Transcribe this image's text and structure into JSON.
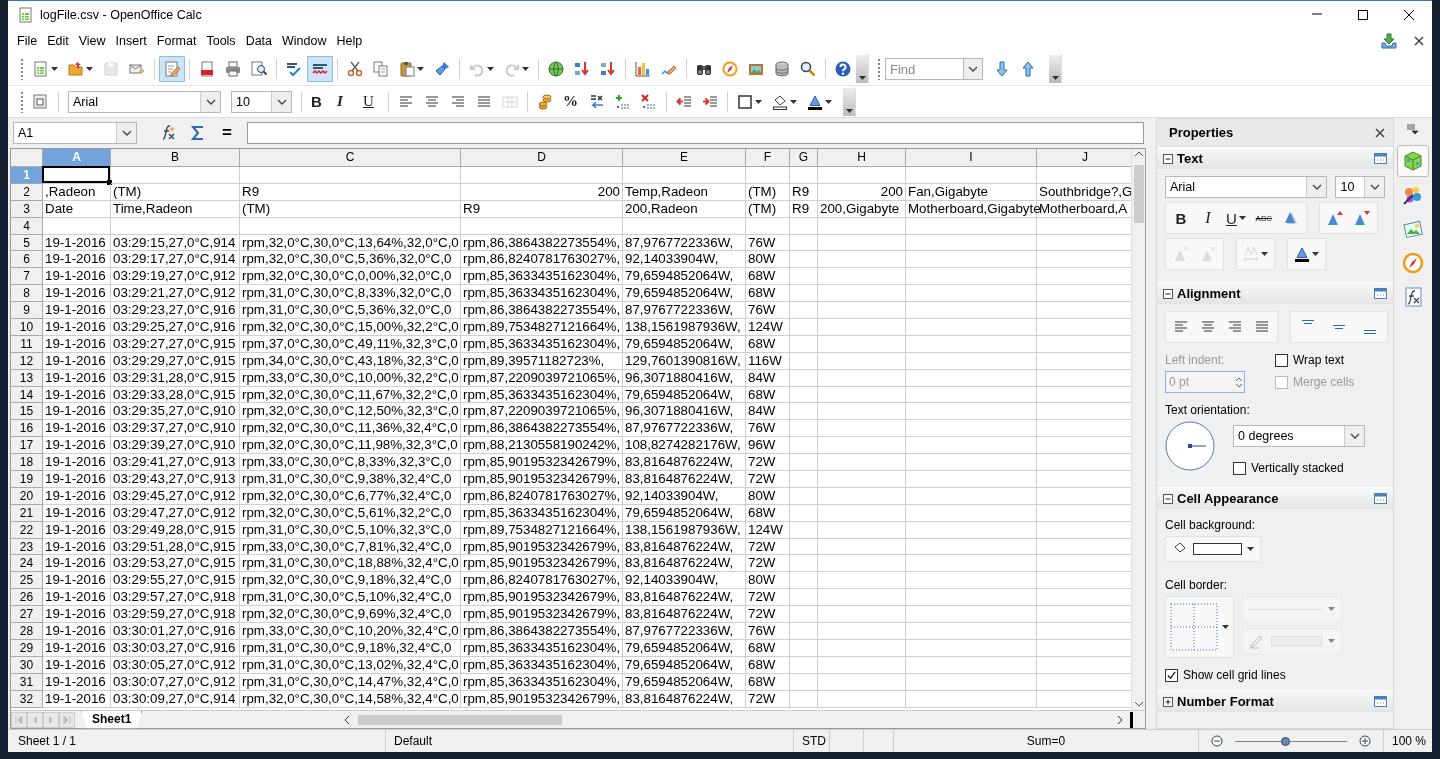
{
  "window": {
    "title": "logFile.csv - OpenOffice Calc"
  },
  "menu": [
    "File",
    "Edit",
    "View",
    "Insert",
    "Format",
    "Tools",
    "Data",
    "Window",
    "Help"
  ],
  "toolbar_1": {
    "groups": [
      [
        {
          "kind": "button",
          "pressed": false,
          "disabled": false,
          "dropdown": true
        },
        {
          "kind": "button",
          "pressed": false,
          "disabled": false,
          "dropdown": true
        },
        {
          "kind": "button",
          "pressed": false,
          "disabled": true,
          "dropdown": false
        },
        {
          "kind": "button",
          "pressed": false,
          "disabled": false,
          "dropdown": false
        }
      ],
      [
        {
          "kind": "button",
          "pressed": true,
          "disabled": false,
          "dropdown": false
        }
      ],
      [
        {
          "kind": "button",
          "pressed": false,
          "disabled": false,
          "dropdown": false
        },
        {
          "kind": "button",
          "pressed": false,
          "disabled": false,
          "dropdown": false
        },
        {
          "kind": "button",
          "pressed": false,
          "disabled": false,
          "dropdown": false
        }
      ],
      [
        {
          "kind": "button",
          "pressed": false,
          "disabled": false,
          "dropdown": false
        },
        {
          "kind": "button",
          "pressed": true,
          "disabled": false,
          "dropdown": false
        }
      ],
      [
        {
          "kind": "button",
          "pressed": false,
          "disabled": false,
          "dropdown": false
        },
        {
          "kind": "button",
          "pressed": false,
          "disabled": false,
          "dropdown": false
        },
        {
          "kind": "button",
          "pressed": false,
          "disabled": false,
          "dropdown": true
        },
        {
          "kind": "button",
          "pressed": false,
          "disabled": false,
          "dropdown": false
        }
      ],
      [
        {
          "kind": "button",
          "pressed": false,
          "disabled": true,
          "dropdown": true
        },
        {
          "kind": "button",
          "pressed": false,
          "disabled": true,
          "dropdown": true
        }
      ],
      [
        {
          "kind": "button",
          "pressed": false,
          "disabled": false,
          "dropdown": false
        },
        {
          "kind": "button",
          "pressed": false,
          "disabled": false,
          "dropdown": false
        },
        {
          "kind": "button",
          "pressed": false,
          "disabled": false,
          "dropdown": false
        }
      ],
      [
        {
          "kind": "button",
          "pressed": false,
          "disabled": false,
          "dropdown": false
        },
        {
          "kind": "button",
          "pressed": false,
          "disabled": false,
          "dropdown": false
        }
      ],
      [
        {
          "kind": "button",
          "pressed": false,
          "disabled": false,
          "dropdown": false
        },
        {
          "kind": "button",
          "pressed": false,
          "disabled": false,
          "dropdown": false
        },
        {
          "kind": "button",
          "pressed": false,
          "disabled": false,
          "dropdown": false
        },
        {
          "kind": "button",
          "pressed": false,
          "disabled": false,
          "dropdown": false
        },
        {
          "kind": "button",
          "pressed": false,
          "disabled": false,
          "dropdown": false
        }
      ],
      [
        {
          "kind": "button",
          "pressed": false,
          "disabled": false,
          "dropdown": false
        }
      ]
    ]
  },
  "find_toolbar": {
    "placeholder": "Find"
  },
  "toolbar_2": {
    "groups": [
      [
        {
          "kind": "button",
          "pressed": false,
          "disabled": false,
          "dropdown": false
        }
      ],
      [
        {
          "kind": "combo",
          "value": "Arial"
        },
        {
          "kind": "combo",
          "value": "10"
        }
      ],
      [
        {
          "kind": "glyph",
          "text": "B",
          "pressed": false,
          "disabled": false,
          "dropdown": false
        },
        {
          "kind": "glyph",
          "text": "I",
          "pressed": false,
          "disabled": false,
          "dropdown": false
        },
        {
          "kind": "glyph",
          "text": "U",
          "pressed": false,
          "disabled": false,
          "dropdown": false
        }
      ],
      [
        {
          "kind": "button",
          "pressed": false,
          "disabled": false,
          "dropdown": false
        },
        {
          "kind": "button",
          "pressed": false,
          "disabled": false,
          "dropdown": false
        },
        {
          "kind": "button",
          "pressed": false,
          "disabled": false,
          "dropdown": false
        },
        {
          "kind": "button",
          "pressed": false,
          "disabled": false,
          "dropdown": false
        },
        {
          "kind": "button",
          "pressed": false,
          "disabled": true,
          "dropdown": false
        }
      ],
      [
        {
          "kind": "button",
          "pressed": false,
          "disabled": false,
          "dropdown": false
        },
        {
          "kind": "glyph",
          "text": "%",
          "pressed": false,
          "disabled": false,
          "dropdown": false
        },
        {
          "kind": "button",
          "pressed": false,
          "disabled": false,
          "dropdown": false
        },
        {
          "kind": "button",
          "pressed": false,
          "disabled": false,
          "dropdown": false
        },
        {
          "kind": "button",
          "pressed": false,
          "disabled": false,
          "dropdown": false
        }
      ],
      [
        {
          "kind": "button",
          "pressed": false,
          "disabled": false,
          "dropdown": false
        },
        {
          "kind": "button",
          "pressed": false,
          "disabled": false,
          "dropdown": false
        }
      ],
      [
        {
          "kind": "button",
          "pressed": false,
          "disabled": false,
          "dropdown": true
        },
        {
          "kind": "button",
          "pressed": false,
          "disabled": false,
          "dropdown": true
        },
        {
          "kind": "button",
          "pressed": false,
          "disabled": false,
          "dropdown": true
        }
      ]
    ]
  },
  "formula_bar": {
    "name_box": "A1",
    "equals": "="
  },
  "sheet": {
    "columns": [
      {
        "label": "A",
        "selected": true
      },
      {
        "label": "B",
        "selected": false
      },
      {
        "label": "C",
        "selected": false
      },
      {
        "label": "D",
        "selected": false
      },
      {
        "label": "E",
        "selected": false
      },
      {
        "label": "F",
        "selected": false
      },
      {
        "label": "G",
        "selected": false
      },
      {
        "label": "H",
        "selected": false
      },
      {
        "label": "I",
        "selected": false
      },
      {
        "label": "J",
        "selected": false
      }
    ],
    "rows": [
      {
        "header": "1",
        "selected": true,
        "cells": []
      },
      {
        "header": "2",
        "selected": false,
        "cells": [
          ",Radeon",
          "(TM)",
          "R9",
          {
            "kind": "number",
            "text": "200"
          },
          "Temp,Radeon",
          "(TM)",
          "R9",
          {
            "kind": "number",
            "text": "200"
          },
          "Fan,Gigabyte",
          "Southbridge?,G"
        ]
      },
      {
        "header": "3",
        "selected": false,
        "cells": [
          "Date",
          "Time,Radeon",
          "(TM)",
          "R9",
          "200,Radeon",
          "(TM)",
          "R9",
          "200,Gigabyte",
          "Motherboard,Gigabyte",
          "Motherboard,A"
        ]
      },
      {
        "header": "4",
        "selected": false,
        "cells": []
      },
      {
        "header": "5",
        "selected": false,
        "cells": [
          "19-1-2016",
          "03:29:15,27,0°C,914",
          "rpm,32,0°C,30,0°C,13,64%,32,0°C,0",
          "rpm,86,3864382273554%,",
          "87,9767722336W,",
          "76W"
        ]
      },
      {
        "header": "6",
        "selected": false,
        "cells": [
          "19-1-2016",
          "03:29:17,27,0°C,914",
          "rpm,32,0°C,30,0°C,5,36%,32,0°C,0",
          "rpm,86,8240781763027%,",
          "92,14033904W,",
          "80W"
        ]
      },
      {
        "header": "7",
        "selected": false,
        "cells": [
          "19-1-2016",
          "03:29:19,27,0°C,912",
          "rpm,32,0°C,30,0°C,0,00%,32,0°C,0",
          "rpm,85,3633435162304%,",
          "79,6594852064W,",
          "68W"
        ]
      },
      {
        "header": "8",
        "selected": false,
        "cells": [
          "19-1-2016",
          "03:29:21,27,0°C,912",
          "rpm,31,0°C,30,0°C,8,33%,32,0°C,0",
          "rpm,85,3633435162304%,",
          "79,6594852064W,",
          "68W"
        ]
      },
      {
        "header": "9",
        "selected": false,
        "cells": [
          "19-1-2016",
          "03:29:23,27,0°C,916",
          "rpm,31,0°C,30,0°C,5,36%,32,0°C,0",
          "rpm,86,3864382273554%,",
          "87,9767722336W,",
          "76W"
        ]
      },
      {
        "header": "10",
        "selected": false,
        "cells": [
          "19-1-2016",
          "03:29:25,27,0°C,916",
          "rpm,32,0°C,30,0°C,15,00%,32,2°C,0",
          "rpm,89,7534827121664%,",
          "138,1561987936W,",
          "124W"
        ]
      },
      {
        "header": "11",
        "selected": false,
        "cells": [
          "19-1-2016",
          "03:29:27,27,0°C,915",
          "rpm,37,0°C,30,0°C,49,11%,32,3°C,0",
          "rpm,85,3633435162304%,",
          "79,6594852064W,",
          "68W"
        ]
      },
      {
        "header": "12",
        "selected": false,
        "cells": [
          "19-1-2016",
          "03:29:29,27,0°C,915",
          "rpm,34,0°C,30,0°C,43,18%,32,3°C,0",
          "rpm,89,39571182723%,",
          "129,7601390816W,",
          "116W"
        ]
      },
      {
        "header": "13",
        "selected": false,
        "cells": [
          "19-1-2016",
          "03:29:31,28,0°C,915",
          "rpm,33,0°C,30,0°C,10,00%,32,2°C,0",
          "rpm,87,2209039721065%,",
          "96,3071880416W,",
          "84W"
        ]
      },
      {
        "header": "14",
        "selected": false,
        "cells": [
          "19-1-2016",
          "03:29:33,28,0°C,915",
          "rpm,32,0°C,30,0°C,11,67%,32,2°C,0",
          "rpm,85,3633435162304%,",
          "79,6594852064W,",
          "68W"
        ]
      },
      {
        "header": "15",
        "selected": false,
        "cells": [
          "19-1-2016",
          "03:29:35,27,0°C,910",
          "rpm,32,0°C,30,0°C,12,50%,32,3°C,0",
          "rpm,87,2209039721065%,",
          "96,3071880416W,",
          "84W"
        ]
      },
      {
        "header": "16",
        "selected": false,
        "cells": [
          "19-1-2016",
          "03:29:37,27,0°C,910",
          "rpm,32,0°C,30,0°C,11,36%,32,4°C,0",
          "rpm,86,3864382273554%,",
          "87,9767722336W,",
          "76W"
        ]
      },
      {
        "header": "17",
        "selected": false,
        "cells": [
          "19-1-2016",
          "03:29:39,27,0°C,910",
          "rpm,32,0°C,30,0°C,11,98%,32,3°C,0",
          "rpm,88,2130558190242%,",
          "108,8274282176W,",
          "96W"
        ]
      },
      {
        "header": "18",
        "selected": false,
        "cells": [
          "19-1-2016",
          "03:29:41,27,0°C,913",
          "rpm,33,0°C,30,0°C,8,33%,32,3°C,0",
          "rpm,85,9019532342679%,",
          "83,8164876224W,",
          "72W"
        ]
      },
      {
        "header": "19",
        "selected": false,
        "cells": [
          "19-1-2016",
          "03:29:43,27,0°C,913",
          "rpm,31,0°C,30,0°C,9,38%,32,4°C,0",
          "rpm,85,9019532342679%,",
          "83,8164876224W,",
          "72W"
        ]
      },
      {
        "header": "20",
        "selected": false,
        "cells": [
          "19-1-2016",
          "03:29:45,27,0°C,912",
          "rpm,32,0°C,30,0°C,6,77%,32,4°C,0",
          "rpm,86,8240781763027%,",
          "92,14033904W,",
          "80W"
        ]
      },
      {
        "header": "21",
        "selected": false,
        "cells": [
          "19-1-2016",
          "03:29:47,27,0°C,912",
          "rpm,32,0°C,30,0°C,5,61%,32,2°C,0",
          "rpm,85,3633435162304%,",
          "79,6594852064W,",
          "68W"
        ]
      },
      {
        "header": "22",
        "selected": false,
        "cells": [
          "19-1-2016",
          "03:29:49,28,0°C,915",
          "rpm,31,0°C,30,0°C,5,10%,32,3°C,0",
          "rpm,89,7534827121664%,",
          "138,1561987936W,",
          "124W"
        ]
      },
      {
        "header": "23",
        "selected": false,
        "cells": [
          "19-1-2016",
          "03:29:51,28,0°C,915",
          "rpm,33,0°C,30,0°C,7,81%,32,4°C,0",
          "rpm,85,9019532342679%,",
          "83,8164876224W,",
          "72W"
        ]
      },
      {
        "header": "24",
        "selected": false,
        "cells": [
          "19-1-2016",
          "03:29:53,27,0°C,915",
          "rpm,31,0°C,30,0°C,18,88%,32,4°C,0",
          "rpm,85,9019532342679%,",
          "83,8164876224W,",
          "72W"
        ]
      },
      {
        "header": "25",
        "selected": false,
        "cells": [
          "19-1-2016",
          "03:29:55,27,0°C,915",
          "rpm,32,0°C,30,0°C,9,18%,32,4°C,0",
          "rpm,86,8240781763027%,",
          "92,14033904W,",
          "80W"
        ]
      },
      {
        "header": "26",
        "selected": false,
        "cells": [
          "19-1-2016",
          "03:29:57,27,0°C,918",
          "rpm,31,0°C,30,0°C,5,10%,32,4°C,0",
          "rpm,85,9019532342679%,",
          "83,8164876224W,",
          "72W"
        ]
      },
      {
        "header": "27",
        "selected": false,
        "cells": [
          "19-1-2016",
          "03:29:59,27,0°C,918",
          "rpm,32,0°C,30,0°C,9,69%,32,4°C,0",
          "rpm,85,9019532342679%,",
          "83,8164876224W,",
          "72W"
        ]
      },
      {
        "header": "28",
        "selected": false,
        "cells": [
          "19-1-2016",
          "03:30:01,27,0°C,916",
          "rpm,33,0°C,30,0°C,10,20%,32,4°C,0",
          "rpm,86,3864382273554%,",
          "87,9767722336W,",
          "76W"
        ]
      },
      {
        "header": "29",
        "selected": false,
        "cells": [
          "19-1-2016",
          "03:30:03,27,0°C,916",
          "rpm,31,0°C,30,0°C,9,18%,32,4°C,0",
          "rpm,85,3633435162304%,",
          "79,6594852064W,",
          "68W"
        ]
      },
      {
        "header": "30",
        "selected": false,
        "cells": [
          "19-1-2016",
          "03:30:05,27,0°C,912",
          "rpm,31,0°C,30,0°C,13,02%,32,4°C,0",
          "rpm,85,3633435162304%,",
          "79,6594852064W,",
          "68W"
        ]
      },
      {
        "header": "31",
        "selected": false,
        "cells": [
          "19-1-2016",
          "03:30:07,27,0°C,912",
          "rpm,31,0°C,30,0°C,14,47%,32,4°C,0",
          "rpm,85,3633435162304%,",
          "79,6594852064W,",
          "68W"
        ]
      },
      {
        "header": "32",
        "selected": false,
        "cells": [
          "19-1-2016",
          "03:30:09,27,0°C,914",
          "rpm,32,0°C,30,0°C,14,58%,32,4°C,0",
          "rpm,85,9019532342679%,",
          "83,8164876224W,",
          "72W"
        ]
      }
    ]
  },
  "sheet_tabs": [
    {
      "label": "Sheet1",
      "selected": true
    }
  ],
  "sidebar": {
    "title": "Properties",
    "sections": [
      {
        "kind": "text",
        "title": "Text",
        "expanded": true,
        "font": "Arial",
        "size": "10",
        "buttons": [
          {
            "kind": "glyph",
            "text": "B",
            "disabled": false,
            "dropdown": false
          },
          {
            "kind": "glyph",
            "text": "I",
            "disabled": false,
            "dropdown": false
          },
          {
            "kind": "glyph",
            "text": "U",
            "disabled": false,
            "dropdown": true
          },
          {
            "kind": "glyph",
            "text": "ABC",
            "disabled": false,
            "dropdown": false
          },
          {
            "kind": "icon",
            "disabled": false,
            "dropdown": false
          },
          {
            "kind": "icon",
            "disabled": false,
            "dropdown": false
          },
          {
            "kind": "icon",
            "disabled": false,
            "dropdown": false
          },
          {
            "kind": "icon",
            "disabled": true,
            "dropdown": false
          },
          {
            "kind": "icon",
            "disabled": true,
            "dropdown": false
          },
          {
            "kind": "icon",
            "disabled": true,
            "dropdown": true
          },
          {
            "kind": "icon",
            "disabled": false,
            "dropdown": true
          }
        ]
      },
      {
        "kind": "alignment",
        "title": "Alignment",
        "expanded": true,
        "indent_label": "Left indent:",
        "indent_value": "0 pt",
        "indent_disabled": true,
        "options": [
          {
            "label": "Wrap text",
            "checked": false,
            "disabled": false
          },
          {
            "label": "Merge cells",
            "checked": false,
            "disabled": true
          }
        ],
        "orientation_label": "Text orientation:",
        "orientation": "0 degrees",
        "stacked": {
          "label": "Vertically stacked",
          "checked": false,
          "disabled": false
        }
      },
      {
        "kind": "cell_appearance",
        "title": "Cell Appearance",
        "expanded": true,
        "background_label": "Cell background:",
        "border_label": "Cell border:",
        "line_controls_disabled": true,
        "grid_lines": {
          "label": "Show cell grid lines",
          "checked": true,
          "disabled": false
        }
      },
      {
        "kind": "number_format",
        "title": "Number Format",
        "expanded": false
      }
    ]
  },
  "deck_tabs": [
    {
      "selected": true
    },
    {
      "selected": false
    },
    {
      "selected": false
    },
    {
      "selected": false
    },
    {
      "selected": false
    }
  ],
  "status_bar": {
    "sheet": "Sheet 1 / 1",
    "page_style": "Default",
    "selection_mode": "STD",
    "sum": "Sum=0",
    "zoom_slider": {
      "level": 0.45
    },
    "zoom": "100 %"
  }
}
